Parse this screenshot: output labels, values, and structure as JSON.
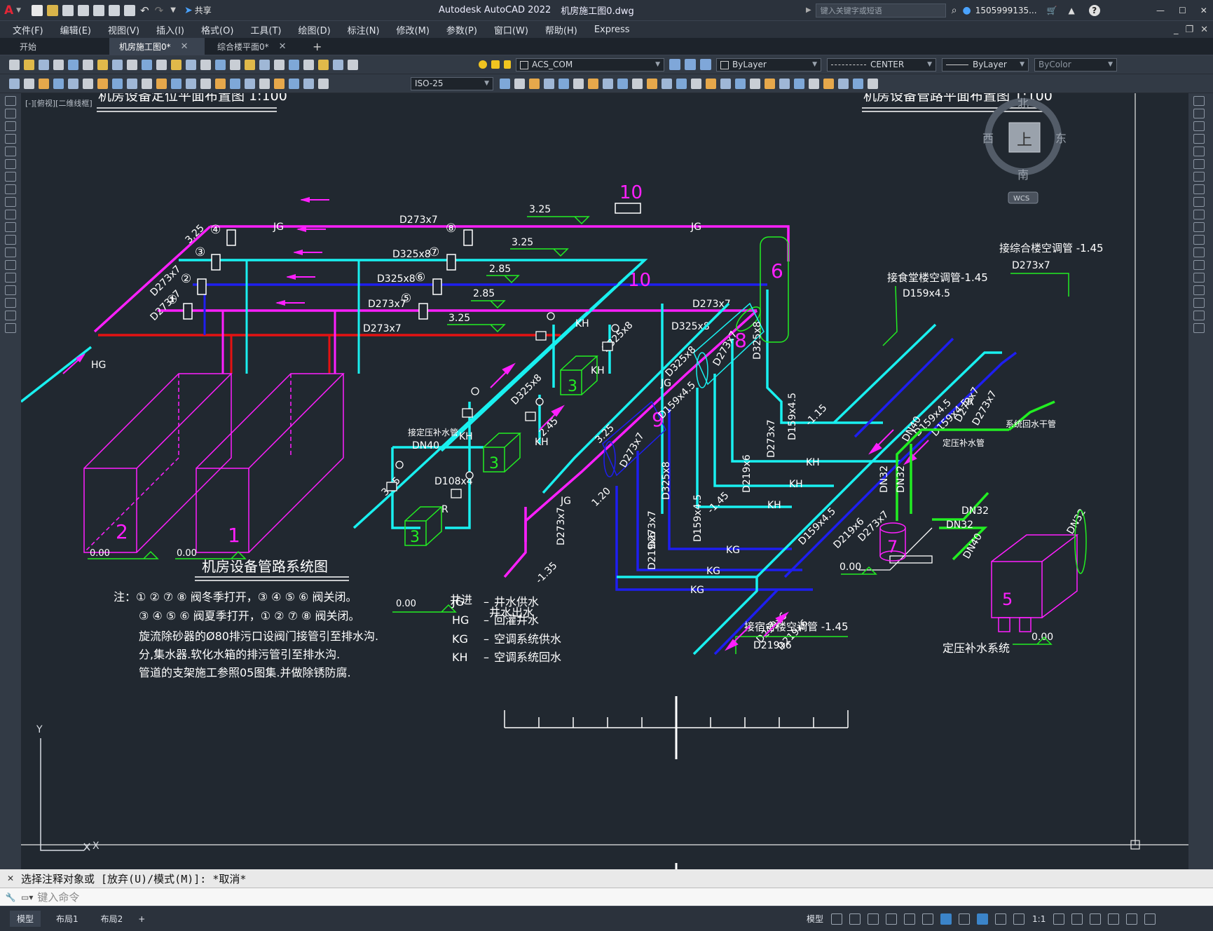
{
  "title": {
    "app": "Autodesk AutoCAD 2022",
    "file": "机房施工图0.dwg",
    "share": "共享",
    "search_placeholder": "键入关键字或短语",
    "user": "1505999135..."
  },
  "menu": [
    "文件(F)",
    "编辑(E)",
    "视图(V)",
    "插入(I)",
    "格式(O)",
    "工具(T)",
    "绘图(D)",
    "标注(N)",
    "修改(M)",
    "参数(P)",
    "窗口(W)",
    "帮助(H)",
    "Express"
  ],
  "tabs": [
    {
      "label": "开始",
      "closable": false,
      "active": false
    },
    {
      "label": "机房施工图0*",
      "closable": true,
      "active": true
    },
    {
      "label": "综合楼平面0*",
      "closable": true,
      "active": false
    }
  ],
  "toolbar": {
    "layer": "ACS_COM",
    "color": "ByLayer",
    "linetype": "CENTER",
    "lineweight": "ByLayer",
    "plotstyle": "ByColor",
    "dimstyle": "ISO-25"
  },
  "viewport_label": "[-][俯视][二维线框]",
  "viewcube": {
    "north": "北",
    "south": "南",
    "east": "东",
    "west": "西",
    "face": "上",
    "wcs": "WCS"
  },
  "drawing": {
    "title_left": "机房设备定位平面布置图 1:100",
    "title_right": "机房设备管路平面布置图 1:100",
    "system_title": "机房设备管路系统图",
    "notes": [
      "注：① ② ⑦ ⑧ 阀冬季打开，③ ④ ⑤ ⑥ 阀关闭。",
      "③ ④ ⑤ ⑥ 阀夏季打开，① ② ⑦ ⑧ 阀关闭。",
      "旋流除砂器的Ø80排污口设阀门接管引至排水沟.",
      "分,集水器.软化水箱的排污管引至排水沟.",
      "管道的支架施工参照05图集.并做除锈防腐."
    ],
    "legend": [
      {
        "code": "JG",
        "desc": "井水供水"
      },
      {
        "code": "HG",
        "desc": "回灌井水"
      },
      {
        "code": "KG",
        "desc": "空调系统供水"
      },
      {
        "code": "KH",
        "desc": "空调系统回水"
      }
    ],
    "labels": {
      "jg": "JG",
      "hg": "HG",
      "kg": "KG",
      "kh": "KH",
      "r": "R",
      "d273": "D273x7",
      "d325": "D325x8",
      "d159": "D159x4.5",
      "d219": "D219x6",
      "d108": "D108x4",
      "dn40": "DN40",
      "dn32": "DN32",
      "e325": "3.25",
      "e285": "2.85",
      "e000": "0.00",
      "e115": "-1.15",
      "e145": "-1.45",
      "e135": "-1.35",
      "e120": "1.20",
      "e245": "2.45",
      "n1": "1",
      "n2": "2",
      "n3": "3",
      "n5": "5",
      "n6": "6",
      "n7": "7",
      "n8": "8",
      "n9": "9",
      "n10": "10",
      "c1": "①",
      "c2": "②",
      "c3": "③",
      "c4": "④",
      "c5": "⑤",
      "c6": "⑥",
      "c7": "⑦",
      "c8": "⑧",
      "well_in": "井进",
      "well_out": "井水出水",
      "to_canteen": "接食堂楼空调管-1.45",
      "to_office": "接综合楼空调管 -1.45",
      "to_dorm": "接宿舍楼空调管 -1.45",
      "constp": "接定压补水管",
      "constp2": "定压补水管",
      "sysreturn": "系统回水干管",
      "makeup_title": "定压补水系统",
      "axis_y": "Y",
      "axis_x": "X"
    }
  },
  "command": {
    "history": "选择注释对象或 [放弃(U)/模式(M)]: *取消*",
    "placeholder": "键入命令"
  },
  "status": {
    "layouts": [
      "模型",
      "布局1",
      "布局2"
    ],
    "model": "模型",
    "scale": "1:1"
  },
  "colors": {
    "magenta": "#ff1fff",
    "cyan": "#19f0f0",
    "blue": "#1e1ef0",
    "red": "#e41212",
    "green": "#22ee22",
    "white": "#ffffff"
  }
}
